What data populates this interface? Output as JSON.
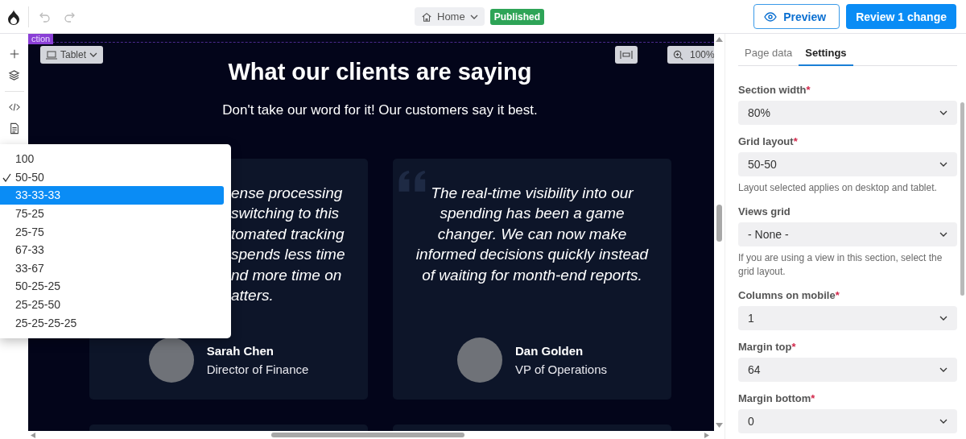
{
  "topbar": {
    "undo_disabled": true,
    "redo_disabled": true,
    "page": "Home",
    "status": "Published",
    "preview": "Preview",
    "review": "Review 1 change"
  },
  "canvas": {
    "section_tag": "ction",
    "device": "Tablet",
    "zoom": "100%",
    "title": "What our clients are saying",
    "subtitle": "Don't take our word for it! Our customers say it best.",
    "testimonials": [
      {
        "quote_lines": [
          "ense processing",
          "switching to this",
          "tomated tracking",
          "spends less time",
          "nd more time on",
          "atters."
        ],
        "partial": true,
        "name": "Sarah Chen",
        "role": "Director of Finance"
      },
      {
        "quote_lines": [
          "The real-time visibility into our",
          "spending has been a game",
          "changer. We can now make",
          "informed decisions quickly instead",
          "of waiting for month-end reports."
        ],
        "partial": false,
        "name": "Dan Golden",
        "role": "VP of Operations"
      }
    ]
  },
  "layout_menu": [
    {
      "label": "100",
      "checked": false,
      "selected": false
    },
    {
      "label": "50-50",
      "checked": true,
      "selected": false
    },
    {
      "label": "33-33-33",
      "checked": false,
      "selected": true
    },
    {
      "label": "75-25",
      "checked": false,
      "selected": false
    },
    {
      "label": "25-75",
      "checked": false,
      "selected": false
    },
    {
      "label": "67-33",
      "checked": false,
      "selected": false
    },
    {
      "label": "33-67",
      "checked": false,
      "selected": false
    },
    {
      "label": "50-25-25",
      "checked": false,
      "selected": false
    },
    {
      "label": "25-25-50",
      "checked": false,
      "selected": false
    },
    {
      "label": "25-25-25-25",
      "checked": false,
      "selected": false
    }
  ],
  "panel": {
    "tabs": [
      {
        "label": "Page data",
        "selected": false
      },
      {
        "label": "Settings",
        "selected": true
      }
    ],
    "fields": [
      {
        "label": "Section width",
        "required_mark": "*",
        "value": "80%"
      },
      {
        "label": "Grid layout",
        "required_mark": "*",
        "value": "50-50",
        "help": "Layout selected applies on desktop and tablet."
      },
      {
        "label": "Views grid",
        "value": "- None -",
        "help": "If you are using a view in this section, select the grid layout."
      },
      {
        "label": "Columns on mobile",
        "required_mark": "*",
        "value": "1"
      },
      {
        "label": "Margin top",
        "required_mark": "*",
        "value": "64"
      },
      {
        "label": "Margin bottom",
        "required_mark": "*",
        "value": "0"
      }
    ]
  }
}
